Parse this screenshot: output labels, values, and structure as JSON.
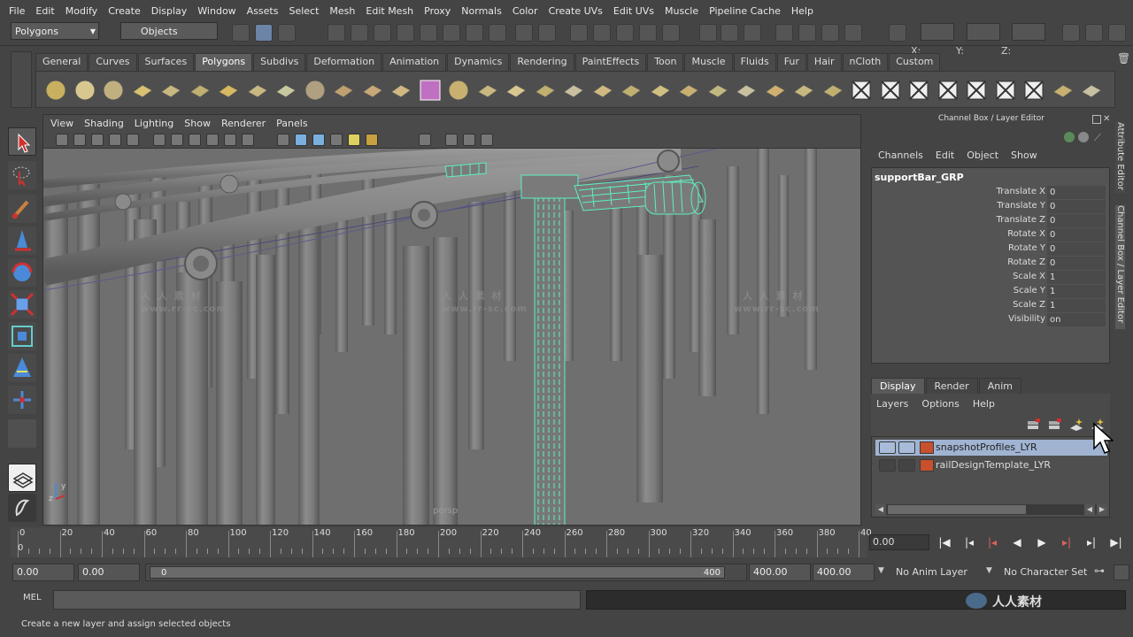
{
  "menubar": [
    "File",
    "Edit",
    "Modify",
    "Create",
    "Display",
    "Window",
    "Assets",
    "Select",
    "Mesh",
    "Edit Mesh",
    "Proxy",
    "Normals",
    "Color",
    "Create UVs",
    "Edit UVs",
    "Muscle",
    "Pipeline Cache",
    "Help"
  ],
  "status": {
    "menuset": "Polygons",
    "selmode": "Objects",
    "x_label": "X:",
    "y_label": "Y:",
    "z_label": "Z:"
  },
  "shelf_tabs": [
    "General",
    "Curves",
    "Surfaces",
    "Polygons",
    "Subdivs",
    "Deformation",
    "Animation",
    "Dynamics",
    "Rendering",
    "PaintEffects",
    "Toon",
    "Muscle",
    "Fluids",
    "Fur",
    "Hair",
    "nCloth",
    "Custom"
  ],
  "shelf_active": "Polygons",
  "viewport": {
    "menu": [
      "View",
      "Shading",
      "Lighting",
      "Show",
      "Renderer",
      "Panels"
    ],
    "camera": "persp"
  },
  "watermark": {
    "cn": "人 人 素 材",
    "url": "www.rr-sc.com",
    "brand": "人人素材"
  },
  "channelbox": {
    "title": "Channel Box / Layer Editor",
    "menu": [
      "Channels",
      "Edit",
      "Object",
      "Show"
    ],
    "object": "supportBar_GRP",
    "attrs": [
      {
        "name": "Translate X",
        "value": "0"
      },
      {
        "name": "Translate Y",
        "value": "0"
      },
      {
        "name": "Translate Z",
        "value": "0"
      },
      {
        "name": "Rotate X",
        "value": "0"
      },
      {
        "name": "Rotate Y",
        "value": "0"
      },
      {
        "name": "Rotate Z",
        "value": "0"
      },
      {
        "name": "Scale X",
        "value": "1"
      },
      {
        "name": "Scale Y",
        "value": "1"
      },
      {
        "name": "Scale Z",
        "value": "1"
      },
      {
        "name": "Visibility",
        "value": "on"
      }
    ]
  },
  "side_tabs": [
    "Attribute Editor",
    "Channel Box / Layer Editor"
  ],
  "layers": {
    "tabs": [
      "Display",
      "Render",
      "Anim"
    ],
    "menu": [
      "Layers",
      "Options",
      "Help"
    ],
    "items": [
      {
        "name": "snapshotProfiles_LYR"
      },
      {
        "name": "railDesignTemplate_LYR"
      }
    ]
  },
  "timeline": {
    "ticks": [
      "0",
      "20",
      "40",
      "60",
      "80",
      "100",
      "120",
      "140",
      "160",
      "180",
      "200",
      "220",
      "240",
      "260",
      "280",
      "300",
      "320",
      "340",
      "360",
      "380",
      "40"
    ],
    "start_frame": "0",
    "current": "0.00"
  },
  "range": {
    "start": "0.00",
    "start2": "0.00",
    "slider_start": "0",
    "slider_end": "400",
    "end": "400.00",
    "end2": "400.00",
    "anim_layer": "No Anim Layer",
    "char_set": "No Character Set"
  },
  "mel": {
    "label": "MEL"
  },
  "help_line": "Create a new layer and assign selected objects"
}
